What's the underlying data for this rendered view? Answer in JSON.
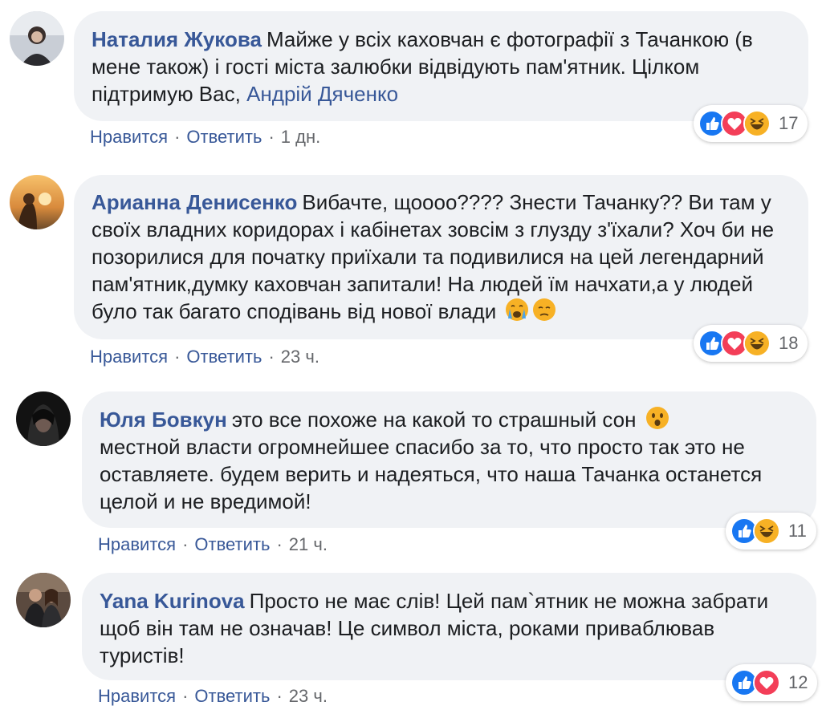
{
  "comments": [
    {
      "author": "Наталия Жукова",
      "text": "Майже у всіх каховчан є фотографії з Тачанкою (в мене також) і гості міста залюбки відвідують пам'ятник. Цілком підтримую Вас,",
      "mention": "Андрій Дяченко",
      "like": "Нравится",
      "reply": "Ответить",
      "time": "1 дн.",
      "reaction_count": "17",
      "reactions": [
        "like-icon",
        "love-icon",
        "haha-icon"
      ]
    },
    {
      "author": "Арианна Денисенко",
      "text": "Вибачте, щоооо???? Знести Тачанку?? Ви там у своїх владних коридорах і кабінетах зовсім з глузду з'їхали? Хоч би не позорилися для початку приїхали та подивилися на цей легендарний пам'ятник,думку каховчан запитали! На людей їм начхати,а у людей було так багато сподівань від нової влади",
      "emojis": [
        "crying-emoji",
        "sad-emoji"
      ],
      "like": "Нравится",
      "reply": "Ответить",
      "time": "23 ч.",
      "reaction_count": "18",
      "reactions": [
        "like-icon",
        "love-icon",
        "haha-icon"
      ]
    },
    {
      "author": "Юля Бовкун",
      "text": "это все похоже на какой то страшный сон",
      "text2": "местной власти огромнейшее спасибо за то, что просто так это не оставляете. будем верить и надеяться, что наша Тачанка останется целой и не вредимой!",
      "emojis": [
        "surprised-emoji"
      ],
      "like": "Нравится",
      "reply": "Ответить",
      "time": "21 ч.",
      "reaction_count": "11",
      "reactions": [
        "like-icon",
        "haha-icon"
      ]
    },
    {
      "author": "Yana Kurinova",
      "text": "Просто не має слів! Цей пам`ятник не можна забрати щоб він там не означав! Це символ міста, роками приваблював туристів!",
      "like": "Нравится",
      "reply": "Ответить",
      "time": "23 ч.",
      "reaction_count": "12",
      "reactions": [
        "like-icon",
        "love-icon"
      ]
    }
  ],
  "colors": {
    "bubble": "#f0f2f5",
    "link": "#385898",
    "meta": "#65676b",
    "like_blue": "#1877f2",
    "love_red": "#f33e58",
    "haha_yellow": "#f7b125"
  }
}
